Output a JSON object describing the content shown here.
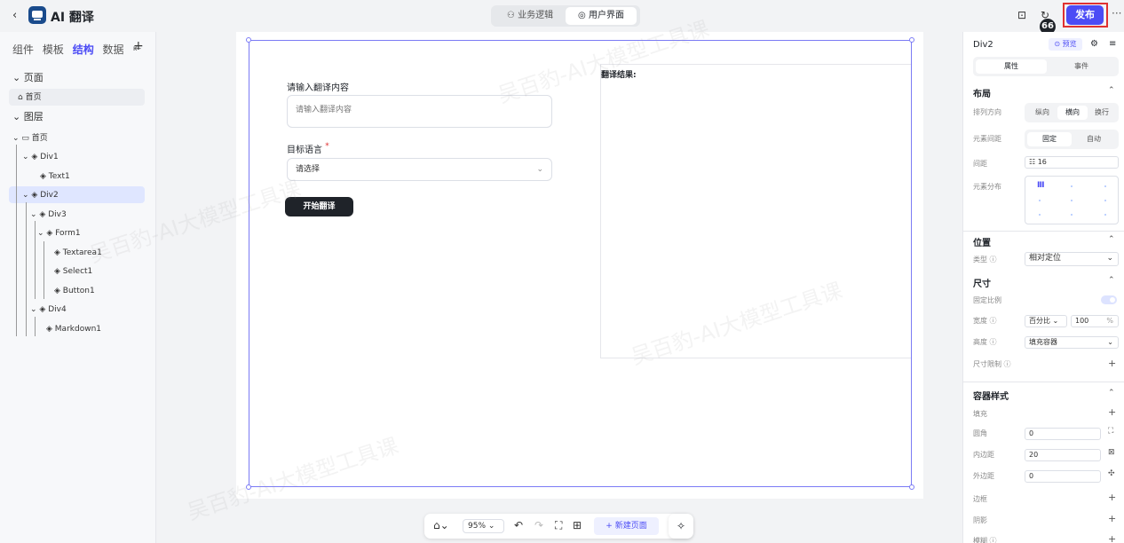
{
  "app": {
    "title": "AI 翻译"
  },
  "mode_switch": {
    "logic": "业务逻辑",
    "ui": "用户界面"
  },
  "topbar": {
    "badge": "66",
    "publish": "发布",
    "more": "···"
  },
  "left_panel": {
    "tabs": [
      "组件",
      "模板",
      "结构",
      "数据"
    ],
    "active_tab": "结构",
    "pages_header": "页面",
    "page_item": "首页",
    "layers_header": "图层",
    "tree": [
      {
        "label": "首页",
        "icon": "page-icon"
      },
      {
        "label": "Div1",
        "icon": "layer-icon"
      },
      {
        "label": "Text1",
        "icon": "layer-icon"
      },
      {
        "label": "Div2",
        "icon": "layer-icon",
        "selected": true
      },
      {
        "label": "Div3",
        "icon": "layer-icon"
      },
      {
        "label": "Form1",
        "icon": "layer-icon"
      },
      {
        "label": "Textarea1",
        "icon": "layer-icon"
      },
      {
        "label": "Select1",
        "icon": "layer-icon"
      },
      {
        "label": "Button1",
        "icon": "layer-icon"
      },
      {
        "label": "Div4",
        "icon": "layer-icon"
      },
      {
        "label": "Markdown1",
        "icon": "layer-icon"
      }
    ]
  },
  "canvas": {
    "form": {
      "content_label": "请输入翻译内容",
      "content_placeholder": "请输入翻译内容",
      "language_label": "目标语言",
      "required_mark": "*",
      "select_placeholder": "请选择",
      "submit_label": "开始翻译"
    },
    "result_label": "翻译结果:",
    "watermark": "吴百豹-AI大模型工具课"
  },
  "bottom_toolbar": {
    "zoom": "95%",
    "new_page": "+ 新建页面"
  },
  "right_panel": {
    "component_name": "Div2",
    "preview": "预览",
    "tabs": [
      "属性",
      "事件"
    ],
    "layout": {
      "title": "布局",
      "direction_label": "排列方向",
      "direction_options": [
        "纵向",
        "横向",
        "换行"
      ],
      "direction_selected": "横向",
      "spacing_mode_label": "元素间距",
      "spacing_mode_options": [
        "固定",
        "自动"
      ],
      "spacing_mode_selected": "固定",
      "gap_label": "间距",
      "gap_value": "16",
      "distribution_label": "元素分布"
    },
    "position": {
      "title": "位置",
      "type_label": "类型",
      "type_value": "相对定位"
    },
    "size": {
      "title": "尺寸",
      "fixed_ratio_label": "固定比例",
      "width_label": "宽度",
      "width_unit": "百分比",
      "width_value": "100",
      "width_suffix": "%",
      "height_label": "高度",
      "height_value": "填充容器",
      "limit_label": "尺寸限制"
    },
    "container_style": {
      "title": "容器样式",
      "fill_label": "填充",
      "radius_label": "圆角",
      "radius_value": "0",
      "padding_label": "内边距",
      "padding_value": "20",
      "margin_label": "外边距",
      "margin_value": "0",
      "border_label": "边框",
      "shadow_label": "阴影",
      "blur_label": "模糊"
    }
  }
}
